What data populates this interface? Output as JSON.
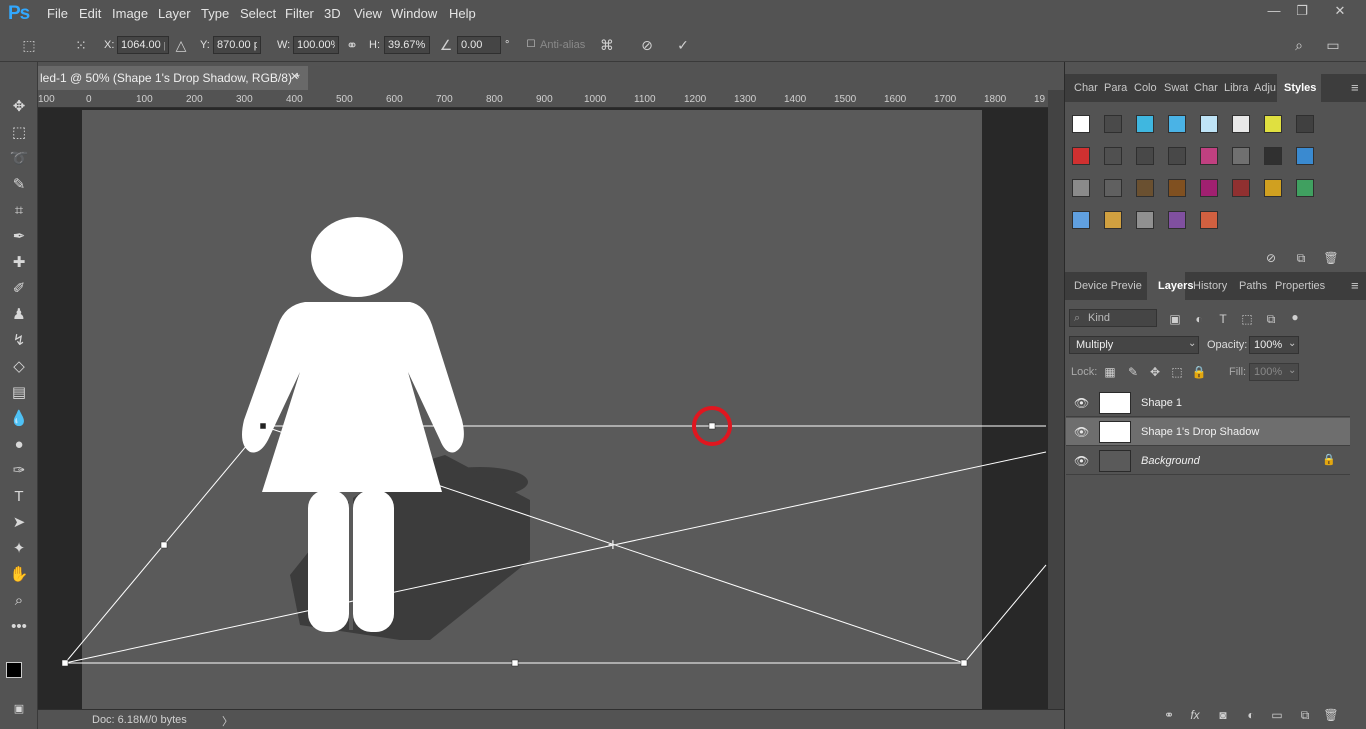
{
  "app": {
    "logo": "Ps"
  },
  "menu": [
    "File",
    "Edit",
    "Image",
    "Layer",
    "Type",
    "Select",
    "Filter",
    "3D",
    "View",
    "Window",
    "Help"
  ],
  "window_controls": {
    "minimize": "—",
    "restore": "❐",
    "close": "✕"
  },
  "options": {
    "x_label": "X:",
    "x_value": "1064.00 px",
    "y_label": "Y:",
    "y_value": "870.00 px",
    "w_label": "W:",
    "w_value": "100.00%",
    "h_label": "H:",
    "h_value": "39.67%",
    "angle_value": "0.00",
    "angle_unit": "°",
    "antialias": "Anti-alias"
  },
  "document": {
    "tab_title": "led-1 @ 50% (Shape 1's Drop Shadow, RGB/8) *",
    "close": "✕",
    "status": "Doc: 6.18M/0 bytes",
    "ruler_labels": [
      "100",
      "0",
      "100",
      "200",
      "300",
      "400",
      "500",
      "600",
      "700",
      "800",
      "900",
      "1000",
      "1100",
      "1200",
      "1300",
      "1400",
      "1500",
      "1600",
      "1700",
      "1800",
      "19"
    ]
  },
  "top_panel": {
    "tabs": [
      "Char",
      "Para",
      "Colo",
      "Swat",
      "Char",
      "Libra",
      "Adju",
      "Styles"
    ],
    "active_tab": "Styles"
  },
  "styles_swatches": [
    "#ffffff",
    "#4a4a4a",
    "#3fb7e0",
    "#4ab3e6",
    "#bfe4f7",
    "#e8e8e8",
    "#e0e040",
    "#404040",
    "#d03030",
    "#505050",
    "#484848",
    "#484848",
    "#c04080",
    "#707070",
    "#303030",
    "#3a8ad0",
    "#8a8a8a",
    "#606060",
    "#6a5030",
    "#805020",
    "#a02070",
    "#903030",
    "#d0a020",
    "#40a060",
    "#60a0e0",
    "#d0a040",
    "#909090",
    "#8050a0",
    "#d06040"
  ],
  "layers_panel": {
    "tabs": [
      "Device Previe",
      "Layers",
      "History",
      "Paths",
      "Properties"
    ],
    "active_tab": "Layers",
    "kind_label": "Kind",
    "blend_mode": "Multiply",
    "opacity_label": "Opacity:",
    "opacity_value": "100%",
    "lock_label": "Lock:",
    "fill_label": "Fill:",
    "fill_value": "100%",
    "layers": [
      {
        "name": "Shape 1",
        "selected": false
      },
      {
        "name": "Shape 1's Drop Shadow",
        "selected": true
      },
      {
        "name": "Background",
        "selected": false
      }
    ]
  }
}
